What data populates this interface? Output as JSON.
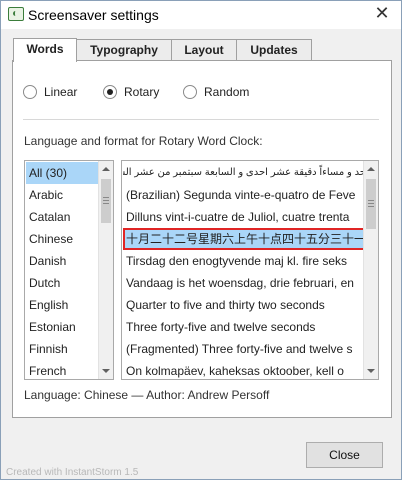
{
  "window": {
    "title": "Screensaver settings",
    "close_glyph": "✕"
  },
  "tabs": [
    {
      "label": "Words"
    },
    {
      "label": "Typography"
    },
    {
      "label": "Layout"
    },
    {
      "label": "Updates"
    }
  ],
  "mode": {
    "options": [
      {
        "label": "Linear",
        "checked": false
      },
      {
        "label": "Rotary",
        "checked": true
      },
      {
        "label": "Random",
        "checked": false
      }
    ]
  },
  "section_heading": "Language and format for Rotary Word Clock:",
  "languages": {
    "items": [
      "All (30)",
      "Arabic",
      "Catalan",
      "Chinese",
      "Danish",
      "Dutch",
      "English",
      "Estonian",
      "Finnish",
      "French"
    ],
    "selected_index": 0
  },
  "samples": {
    "items": [
      "حد و مساءاً دقيقة عشر احدى و السابعة سبتمبر من عشر السادس الخميس",
      "(Brazilian) Segunda vinte-e-quatro de Feve",
      "Dilluns vint-i-cuatre de Juliol, cuatre trenta",
      "十月二十二号星期六上午十点四十五分三十一秒",
      "Tirsdag den enogtyvende maj kl. fire seks",
      "Vandaag is het woensdag, drie februari, en",
      "Quarter to five and thirty two seconds",
      "Three forty-five and twelve seconds",
      "(Fragmented) Three forty-five and twelve s",
      "On kolmapäev, kaheksas oktoober, kell o"
    ],
    "selected_index": 3
  },
  "status": "Language: Chinese — Author: Andrew Persoff",
  "made_with": "Created with InstantStorm 1.5",
  "close_button": "Close"
}
